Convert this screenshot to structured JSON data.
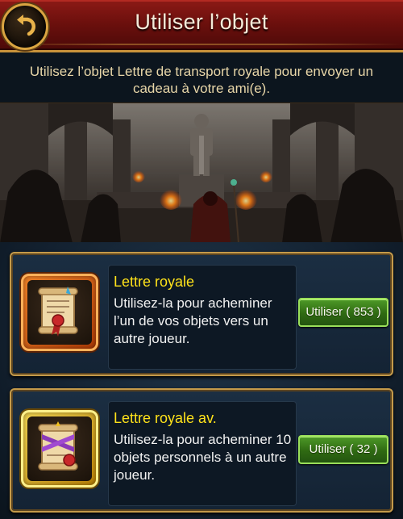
{
  "header": {
    "title": "Utiliser l’objet",
    "back_icon": "back-arrow-icon"
  },
  "description": "Utilisez l’objet Lettre de transport royale pour envoyer un cadeau à votre ami(e).",
  "items": [
    {
      "name": "Lettre royale",
      "description": "Utilisez-la pour acheminer l’un de vos objets vers un autre joueur.",
      "button_label": "Utiliser ( 853 )",
      "icon": "royal-letter-scroll-icon",
      "frame_color": "#e8741c"
    },
    {
      "name": "Lettre royale av.",
      "description": "Utilisez-la pour acheminer 10 objets personnels à un autre joueur.",
      "button_label": "Utiliser ( 32 )",
      "icon": "advanced-royal-letter-scroll-icon",
      "frame_color": "#f2c21e"
    }
  ],
  "colors": {
    "header_red": "#7a1410",
    "gold_trim": "#c9923a",
    "item_name": "#ffe21a",
    "button_green": "#3f8a1e"
  }
}
